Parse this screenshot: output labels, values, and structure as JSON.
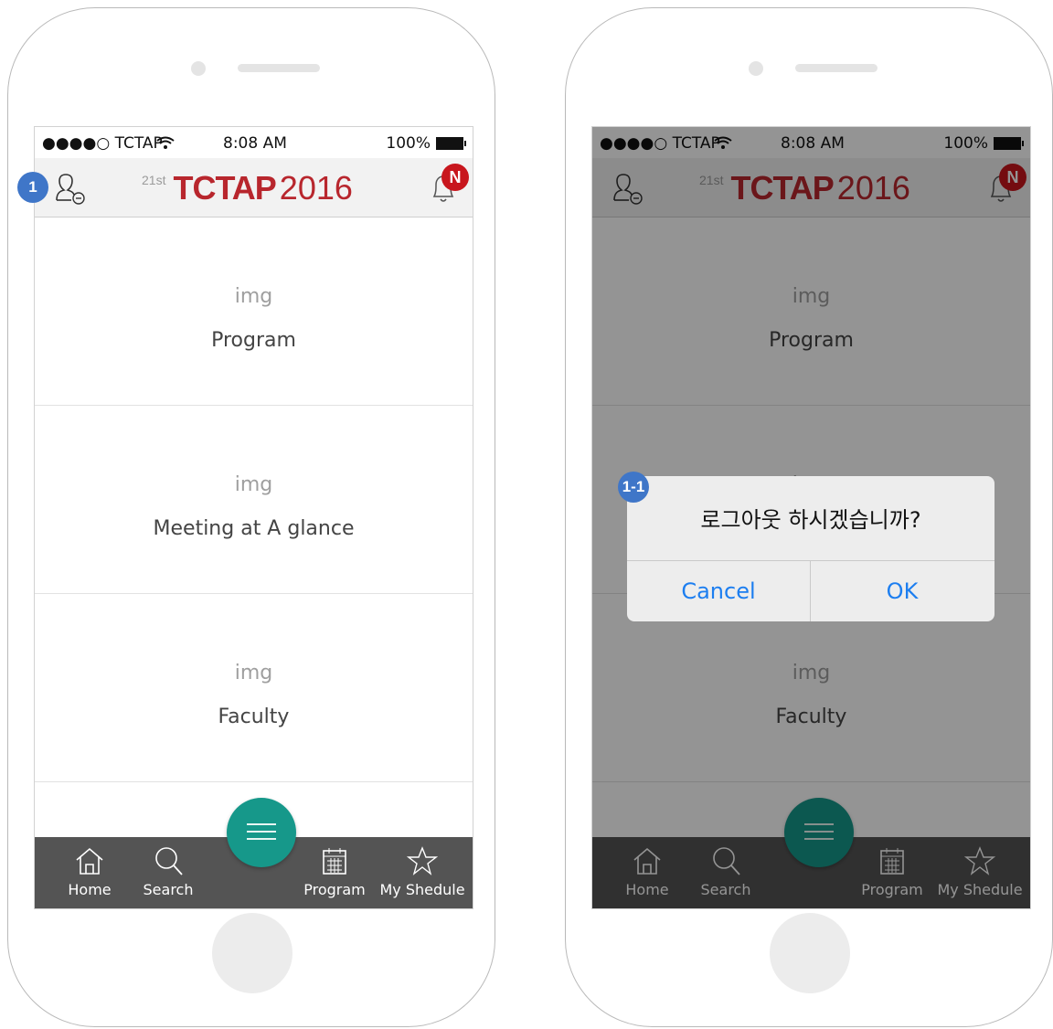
{
  "status_bar": {
    "carrier": "●●●●○ TCTAP",
    "time": "8:08 AM",
    "battery": "100%"
  },
  "header": {
    "ordinal": "21st",
    "brand": "TCTAP",
    "year": "2016",
    "badge": "N"
  },
  "tiles": [
    {
      "img": "img",
      "label": "Program"
    },
    {
      "img": "img",
      "label": "Meeting at A glance"
    },
    {
      "img": "img",
      "label": "Faculty"
    }
  ],
  "tabbar": {
    "home": "Home",
    "search": "Search",
    "program": "Program",
    "schedule": "My Shedule"
  },
  "dialog": {
    "message": "로그아웃 하시겠습니까?",
    "cancel": "Cancel",
    "ok": "OK"
  },
  "markers": {
    "first": "1",
    "second": "1-1"
  },
  "colors": {
    "brand": "#b8262d",
    "fab": "#16988a",
    "tabbar": "#545454",
    "link": "#1c7ef0",
    "badge": "#c8161d",
    "marker": "#3f76c8"
  }
}
